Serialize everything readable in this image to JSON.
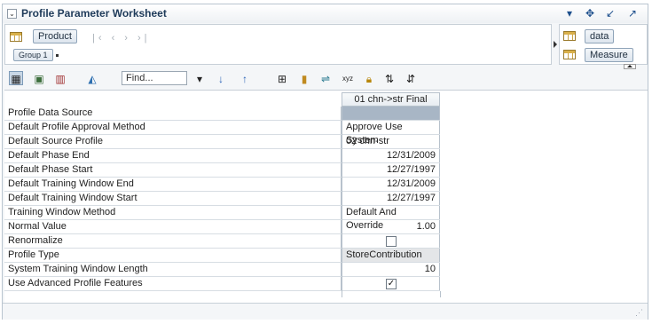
{
  "window": {
    "title": "Profile Parameter Worksheet"
  },
  "title_icons": [
    "chevron-down-icon",
    "move-icon",
    "minimize-icon",
    "maximize-icon"
  ],
  "page_axis": {
    "dimension_label": "Product",
    "group_label": "Group 1"
  },
  "measure_axis": {
    "items": [
      "data",
      "Measure"
    ]
  },
  "toolbar": {
    "find_placeholder": "Find..."
  },
  "table": {
    "column_header": "01 chn->str Final",
    "rows": [
      {
        "label": "Profile Data Source",
        "value": "",
        "type": "highlight"
      },
      {
        "label": "Default Profile Approval Method",
        "value": "Approve Use System",
        "type": "text"
      },
      {
        "label": "Default Source Profile",
        "value": "02 chn-str",
        "type": "text"
      },
      {
        "label": "Default Phase End",
        "value": "12/31/2009",
        "type": "num"
      },
      {
        "label": "Default Phase Start",
        "value": "12/27/1997",
        "type": "num"
      },
      {
        "label": "Default Training Window End",
        "value": "12/31/2009",
        "type": "num"
      },
      {
        "label": "Default Training Window Start",
        "value": "12/27/1997",
        "type": "num"
      },
      {
        "label": "Training Window Method",
        "value": "Default And Override",
        "type": "text"
      },
      {
        "label": "Normal Value",
        "value": "1.00",
        "type": "num"
      },
      {
        "label": "Renormalize",
        "value": "",
        "type": "checkbox",
        "checked": false
      },
      {
        "label": "Profile Type",
        "value": "StoreContribution",
        "type": "readonly"
      },
      {
        "label": "System Training Window Length",
        "value": "10",
        "type": "num"
      },
      {
        "label": "Use Advanced Profile Features",
        "value": "",
        "type": "checkbox",
        "checked": true
      }
    ]
  },
  "colors": {
    "title": "#1f3b5a",
    "highlight_cell": "#a8b6c5",
    "readonly_cell": "#e4e6e8"
  }
}
